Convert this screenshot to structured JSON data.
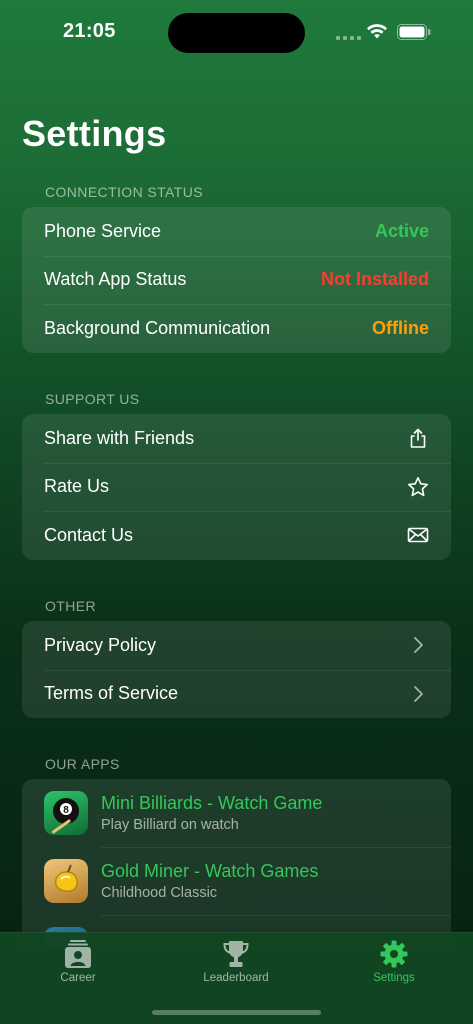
{
  "status_bar": {
    "time": "21:05"
  },
  "page": {
    "title": "Settings"
  },
  "connection": {
    "header": "CONNECTION STATUS",
    "rows": [
      {
        "label": "Phone Service",
        "value": "Active",
        "color": "#34c759"
      },
      {
        "label": "Watch App Status",
        "value": "Not Installed",
        "color": "#ff3b30"
      },
      {
        "label": "Background Communication",
        "value": "Offline",
        "color": "#ff9f0a"
      }
    ]
  },
  "support": {
    "header": "SUPPORT US",
    "rows": [
      {
        "label": "Share with Friends",
        "icon": "share-icon"
      },
      {
        "label": "Rate Us",
        "icon": "star-icon"
      },
      {
        "label": "Contact Us",
        "icon": "envelope-icon"
      }
    ]
  },
  "other": {
    "header": "OTHER",
    "rows": [
      {
        "label": "Privacy Policy",
        "icon": "chevron-right-icon"
      },
      {
        "label": "Terms of Service",
        "icon": "chevron-right-icon"
      }
    ]
  },
  "apps": {
    "header": "OUR APPS",
    "items": [
      {
        "title": "Mini Billiards - Watch Game",
        "subtitle": "Play Billiard on watch",
        "icon": "eight-ball-app-icon"
      },
      {
        "title": "Gold Miner - Watch Games",
        "subtitle": "Childhood Classic",
        "icon": "gold-nugget-app-icon"
      }
    ]
  },
  "tab_bar": {
    "tabs": [
      {
        "label": "Career",
        "icon": "person-card-icon",
        "active": false
      },
      {
        "label": "Leaderboard",
        "icon": "trophy-icon",
        "active": false
      },
      {
        "label": "Settings",
        "icon": "gear-icon",
        "active": true
      }
    ],
    "active_color": "#34c759"
  }
}
